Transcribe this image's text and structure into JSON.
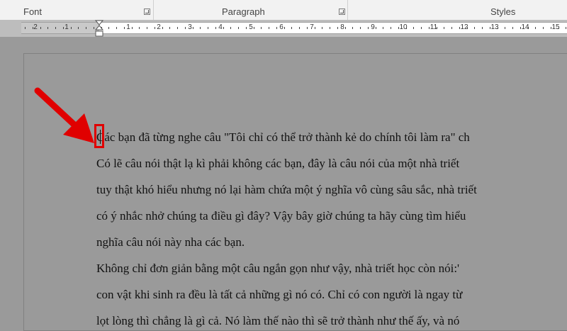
{
  "ribbon": {
    "groups": [
      {
        "label": "Font"
      },
      {
        "label": "Paragraph"
      },
      {
        "label": "Styles"
      }
    ]
  },
  "ruler": {
    "numbers": [
      "2",
      "1",
      "1",
      "2",
      "3",
      "4",
      "5",
      "6",
      "7",
      "8",
      "9",
      "10",
      "11",
      "12",
      "13",
      "14",
      "15"
    ]
  },
  "document": {
    "lines": [
      "Các bạn đã từng nghe câu \"Tôi chỉ có thể trở thành kẻ do chính tôi làm ra\" ch",
      "Có lẽ câu nói thật lạ kì phải không các bạn, đây là câu nói của một nhà triết",
      "tuy thật khó hiểu nhưng nó lại hàm chứa một ý nghĩa vô cùng sâu sắc, nhà triết",
      "có ý nhắc nhở chúng ta điều gì đây? Vậy bây giờ chúng ta hãy cùng tìm hiểu",
      "nghĩa câu nói này nha các bạn.",
      "Không chỉ đơn giản bằng một câu ngắn gọn như vậy, nhà triết học còn nói:'",
      "con vật khi sinh ra đều là tất cả những gì nó có. Chỉ có con người là ngay từ",
      "lọt lòng thì chẳng là gì cả. Nó làm thế nào thì sẽ trở thành như thế ấy, và nó"
    ]
  },
  "colors": {
    "highlight": "#e00000",
    "page_background": "#9a9a9a"
  }
}
